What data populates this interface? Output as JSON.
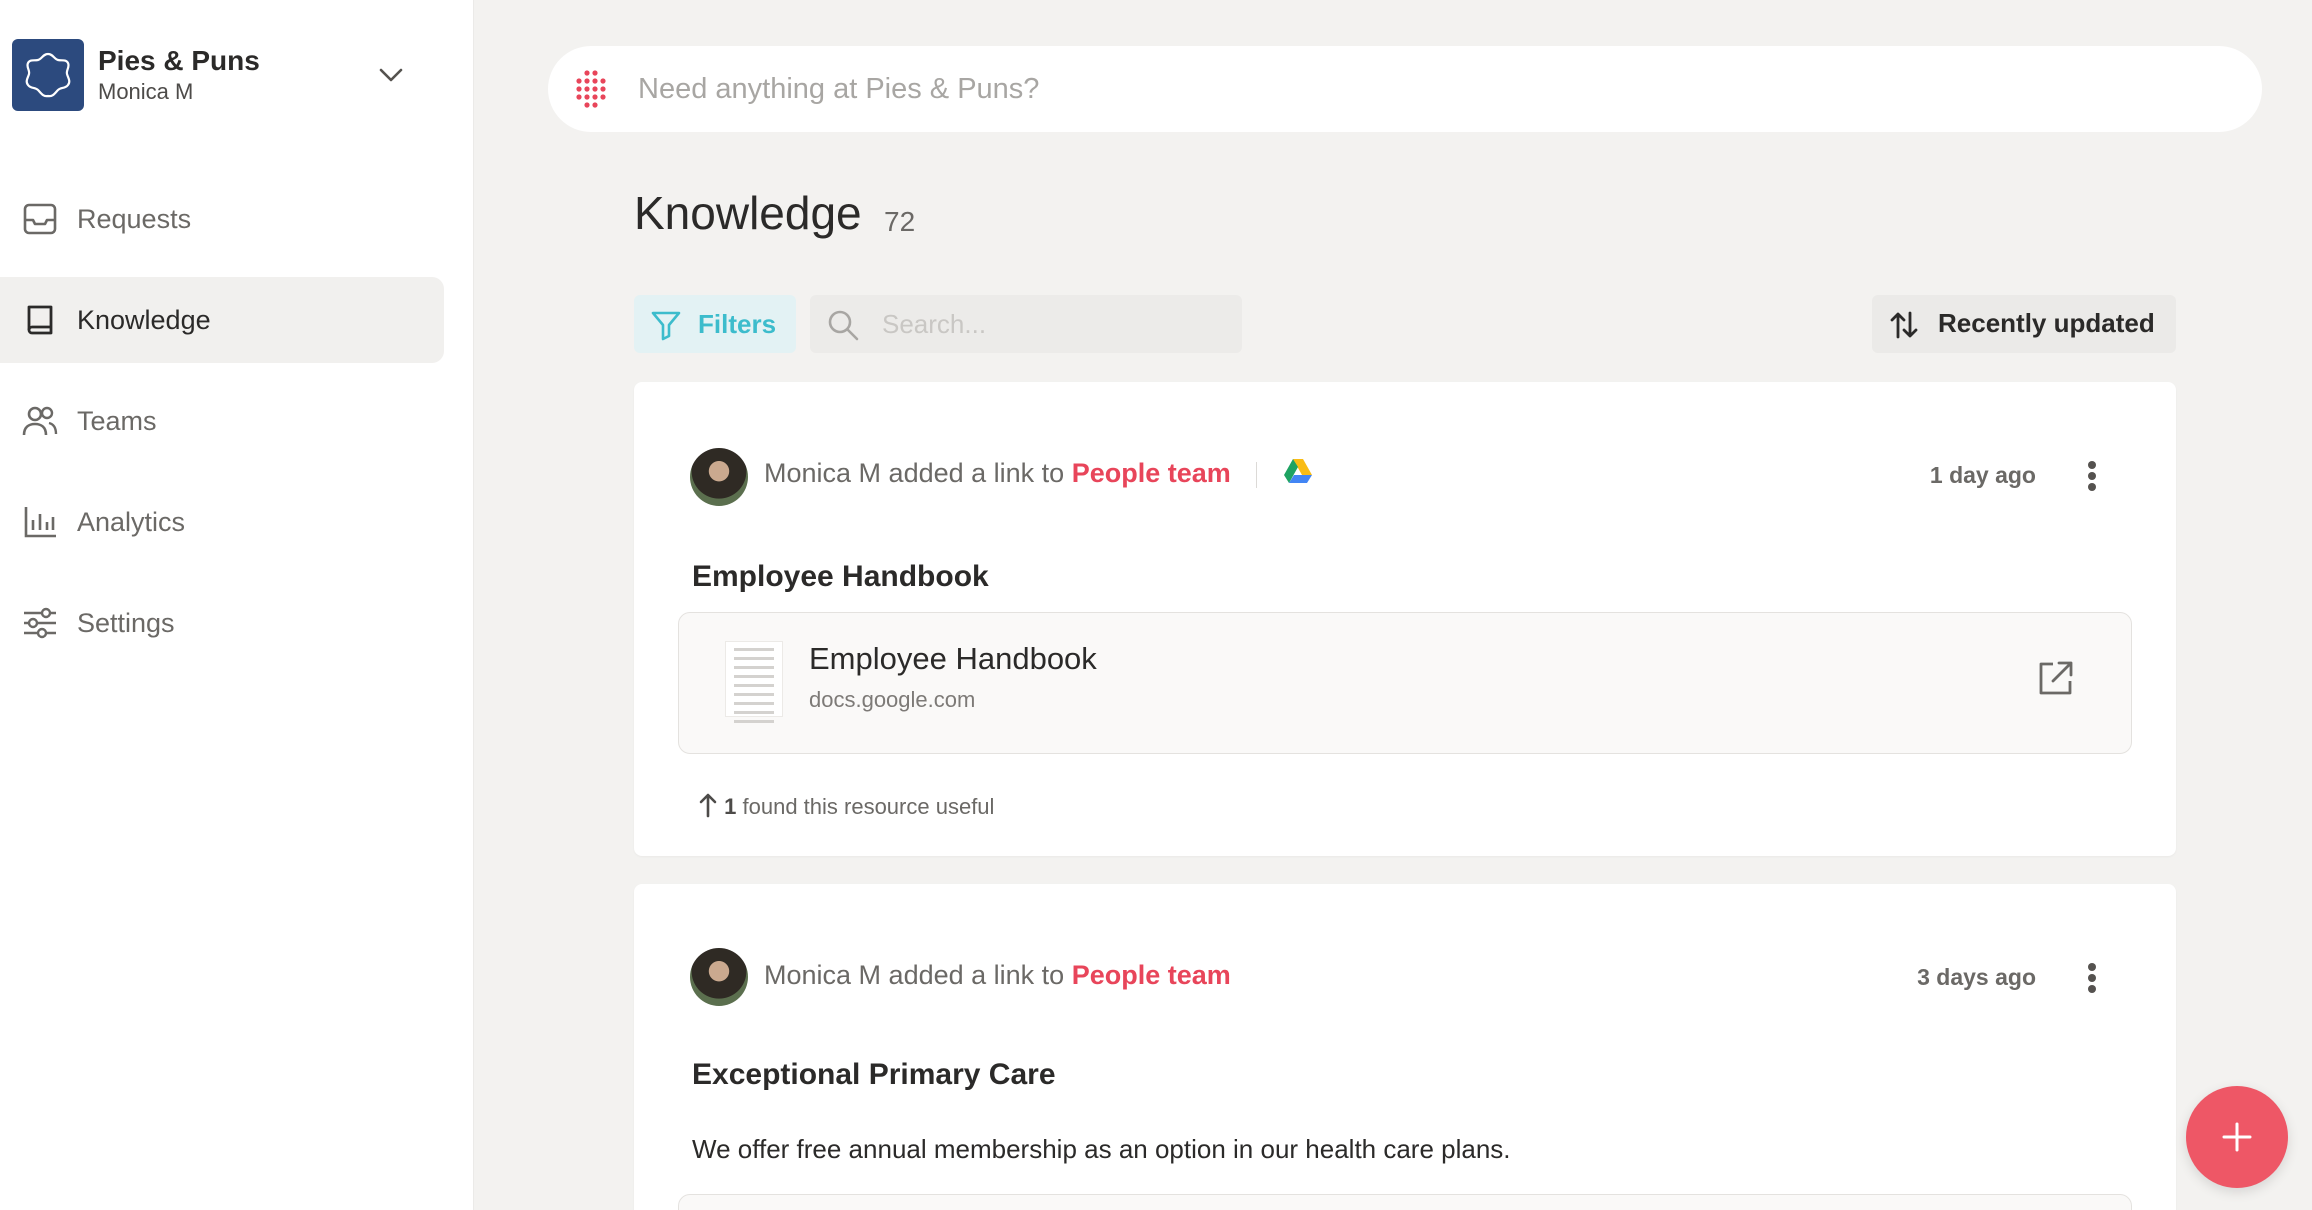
{
  "workspace": {
    "name": "Pies & Puns",
    "user": "Monica M"
  },
  "sidebar": {
    "items": [
      {
        "label": "Requests",
        "icon": "inbox-icon",
        "active": false
      },
      {
        "label": "Knowledge",
        "icon": "book-icon",
        "active": true
      },
      {
        "label": "Teams",
        "icon": "users-icon",
        "active": false
      },
      {
        "label": "Analytics",
        "icon": "bar-chart-icon",
        "active": false
      },
      {
        "label": "Settings",
        "icon": "sliders-icon",
        "active": false
      }
    ]
  },
  "search": {
    "placeholder": "Need anything at Pies & Puns?"
  },
  "page": {
    "title": "Knowledge",
    "count": "72"
  },
  "toolbar": {
    "filters_label": "Filters",
    "search_placeholder": "Search...",
    "sort_label": "Recently updated"
  },
  "cards": [
    {
      "author": "Monica M",
      "action": "added a link to",
      "team": "People team",
      "time": "1 day ago",
      "title": "Employee Handbook",
      "link": {
        "title": "Employee Handbook",
        "host": "docs.google.com"
      },
      "useful_count": "1",
      "useful_text": "found this resource useful"
    },
    {
      "author": "Monica M",
      "action": "added a link to",
      "team": "People team",
      "time": "3 days ago",
      "title": "Exceptional Primary Care",
      "description": "We offer free annual membership as an option in our health care plans."
    }
  ],
  "colors": {
    "accent": "#e8455a",
    "teal": "#3cbccc",
    "fab": "#ee5766",
    "workspace_logo": "#2c4a7e"
  }
}
